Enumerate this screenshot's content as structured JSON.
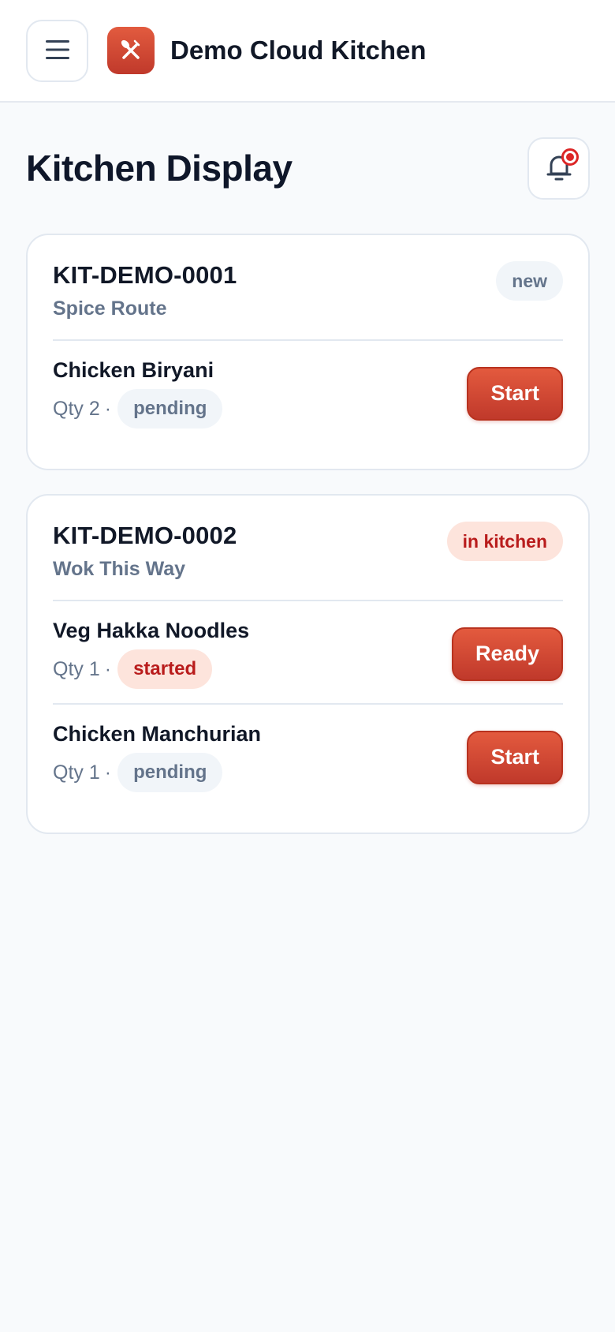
{
  "app": {
    "name": "Demo Cloud Kitchen",
    "accent_color": "#d9442f"
  },
  "header": {
    "menu_icon": "hamburger-icon",
    "logo_icon": "utensils-icon"
  },
  "page": {
    "title": "Kitchen Display",
    "notification_icon": "bell-icon",
    "has_unread": true
  },
  "orders": [
    {
      "id": "KIT-DEMO-0001",
      "brand": "Spice Route",
      "status": "new",
      "items": [
        {
          "name": "Chicken Biryani",
          "qty_label": "Qty 2",
          "status": "pending",
          "action": "Start"
        }
      ]
    },
    {
      "id": "KIT-DEMO-0002",
      "brand": "Wok This Way",
      "status": "in kitchen",
      "items": [
        {
          "name": "Veg Hakka Noodles",
          "qty_label": "Qty 1",
          "status": "started",
          "action": "Ready"
        },
        {
          "name": "Chicken Manchurian",
          "qty_label": "Qty 1",
          "status": "pending",
          "action": "Start"
        }
      ]
    }
  ]
}
